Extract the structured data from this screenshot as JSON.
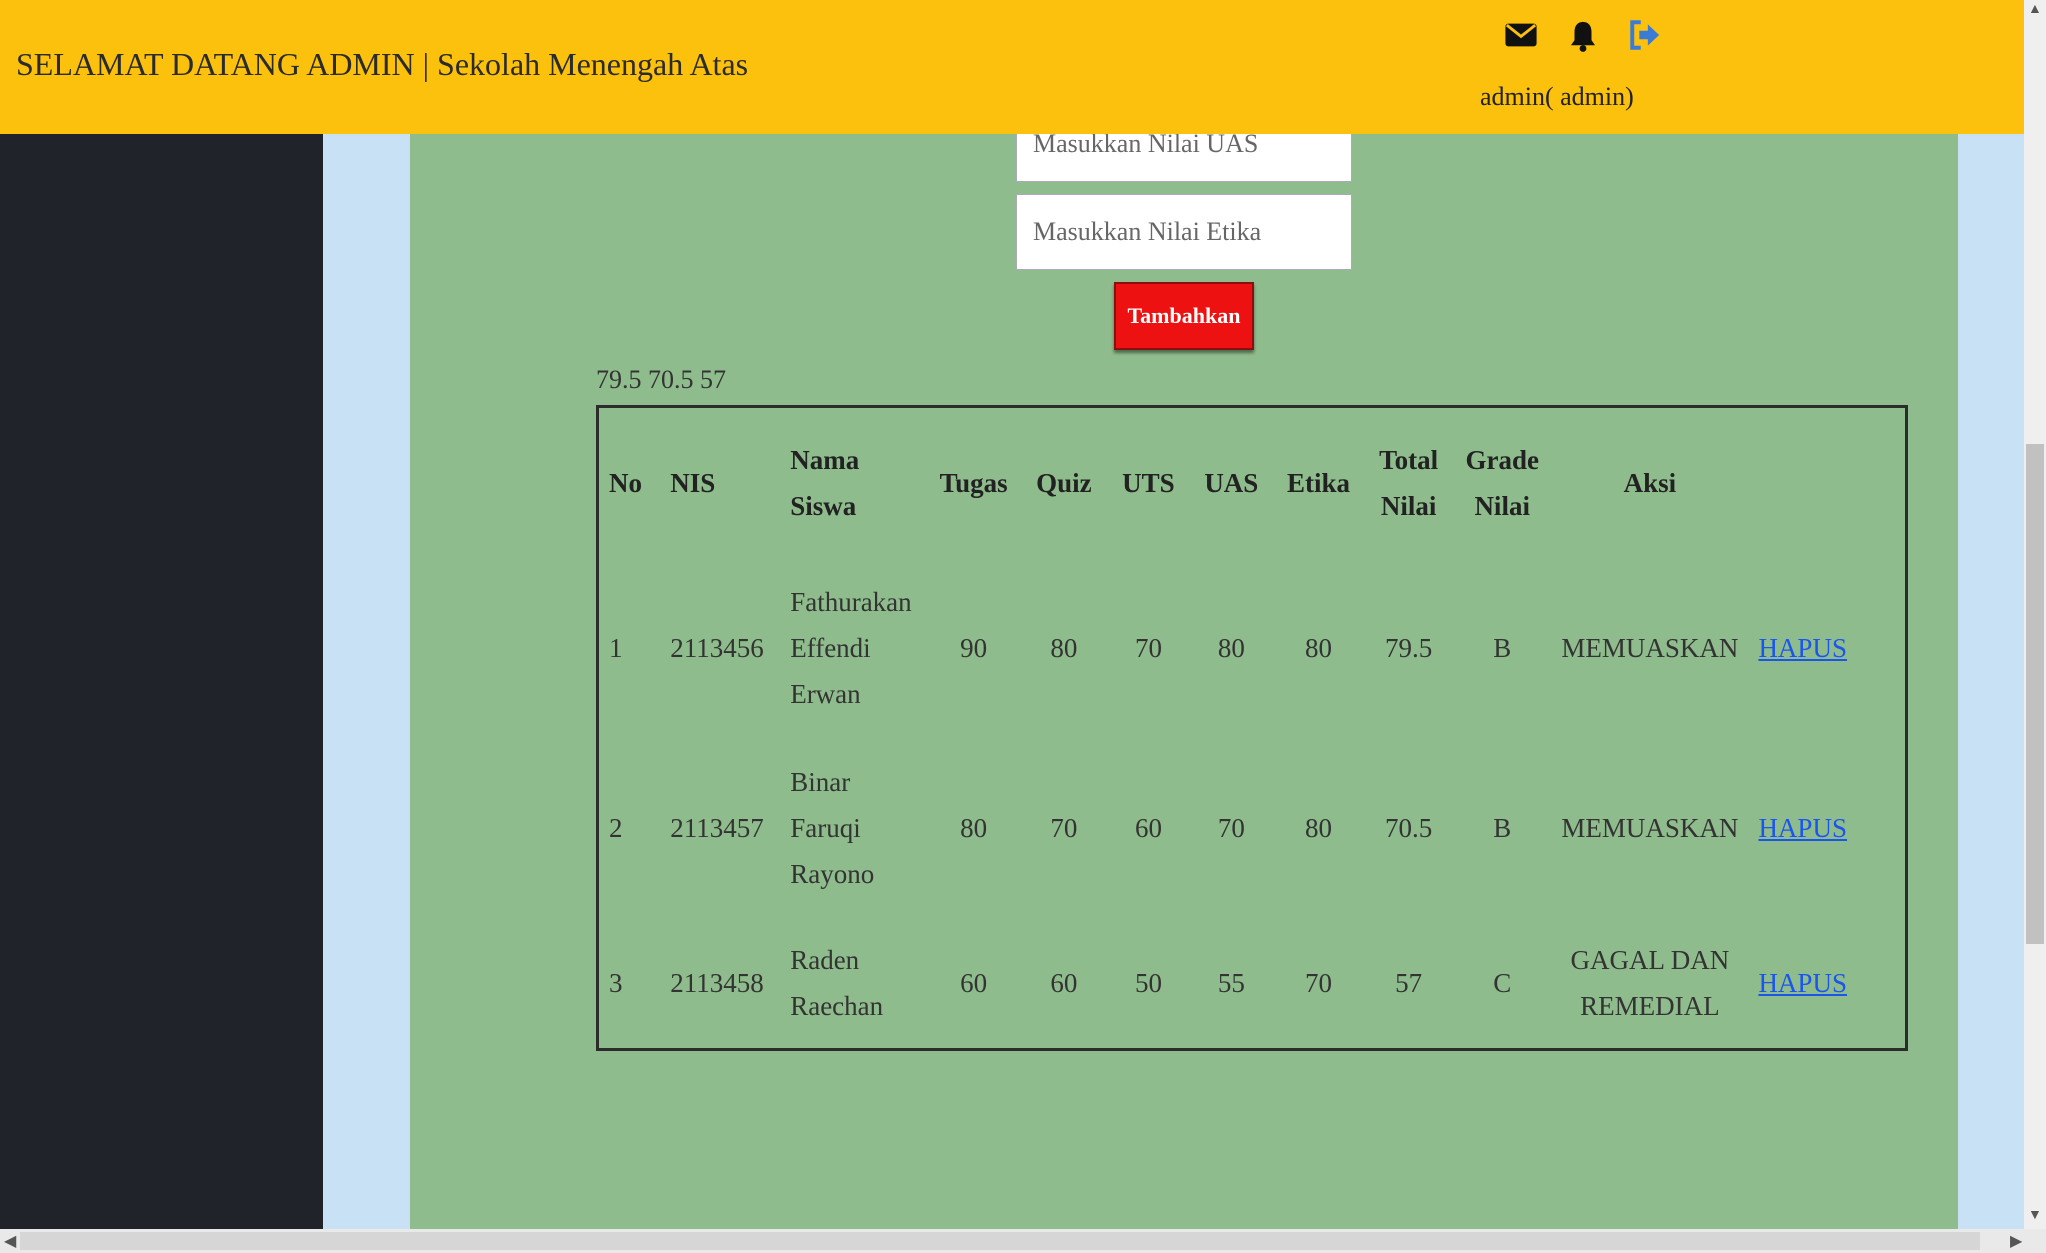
{
  "header": {
    "title": "SELAMAT DATANG ADMIN | Sekolah Menengah Atas",
    "user": "admin( admin)",
    "icons": [
      "envelope-icon",
      "bell-icon",
      "logout-icon"
    ],
    "bg_color": "#fcc10c",
    "logout_color": "#3b7bd8"
  },
  "form": {
    "uas_placeholder": "Masukkan Nilai UAS",
    "etika_placeholder": "Masukkan Nilai Etika",
    "submit_label": "Tambahkan",
    "submit_color": "#ee1111"
  },
  "totals_text": "79.5 70.5 57",
  "table": {
    "headers": {
      "no": "No",
      "nis": "NIS",
      "nama_1": "Nama",
      "nama_2": "Siswa",
      "tugas": "Tugas",
      "quiz": "Quiz",
      "uts": "UTS",
      "uas": "UAS",
      "etika": "Etika",
      "total_1": "Total",
      "total_2": "Nilai",
      "grade_1": "Grade",
      "grade_2": "Nilai",
      "aksi": "Aksi"
    },
    "rows": [
      {
        "no": "1",
        "nis": "2113456",
        "nama": [
          "Fathurakan",
          "Effendi",
          "Erwan"
        ],
        "tugas": "90",
        "quiz": "80",
        "uts": "70",
        "uas": "80",
        "etika": "80",
        "total": "79.5",
        "grade": "B",
        "ket": [
          "MEMUASKAN"
        ],
        "action": "HAPUS"
      },
      {
        "no": "2",
        "nis": "2113457",
        "nama": [
          "Binar",
          "Faruqi",
          "Rayono"
        ],
        "tugas": "80",
        "quiz": "70",
        "uts": "60",
        "uas": "70",
        "etika": "80",
        "total": "70.5",
        "grade": "B",
        "ket": [
          "MEMUASKAN"
        ],
        "action": "HAPUS"
      },
      {
        "no": "3",
        "nis": "2113458",
        "nama": [
          "Raden",
          "Raechan"
        ],
        "tugas": "60",
        "quiz": "60",
        "uts": "50",
        "uas": "55",
        "etika": "70",
        "total": "57",
        "grade": "C",
        "ket": [
          "GAGAL DAN",
          "REMEDIAL"
        ],
        "action": "HAPUS"
      }
    ]
  },
  "colors": {
    "sidebar": "#20232a",
    "main": "#8fbc8c",
    "page": "#c9e1f5",
    "link": "#1a55ee"
  }
}
